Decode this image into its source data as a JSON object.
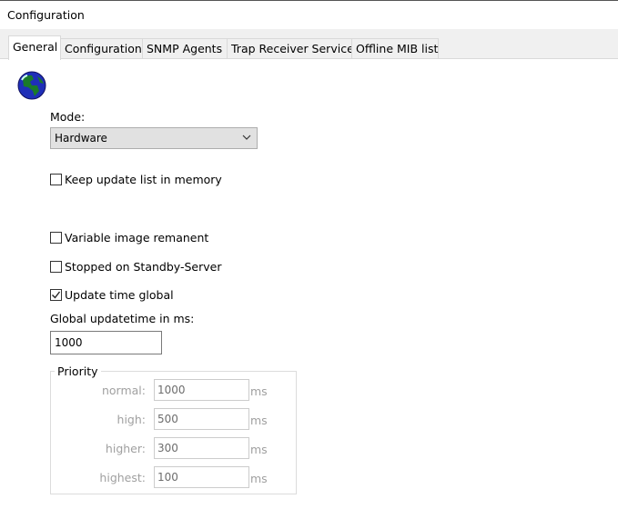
{
  "window": {
    "title": "Configuration"
  },
  "tabs": [
    {
      "label": "General",
      "selected": true
    },
    {
      "label": "Configuration"
    },
    {
      "label": "SNMP Agents"
    },
    {
      "label": "Trap Receiver Service"
    },
    {
      "label": "Offline MIB list"
    }
  ],
  "general": {
    "icon": "globe-icon",
    "mode_label": "Mode:",
    "mode_value": "Hardware",
    "keep_update": {
      "label": "Keep update list in memory",
      "checked": false
    },
    "variable_image": {
      "label": "Variable image remanent",
      "checked": false
    },
    "stopped_standby": {
      "label": "Stopped on Standby-Server",
      "checked": false
    },
    "update_time_global": {
      "label": "Update time global",
      "checked": true
    },
    "global_updatetime_label": "Global updatetime in ms:",
    "global_updatetime_value": "1000",
    "priority": {
      "legend": "Priority",
      "unit": "ms",
      "rows": [
        {
          "label": "normal:",
          "value": "1000"
        },
        {
          "label": "high:",
          "value": "500"
        },
        {
          "label": "higher:",
          "value": "300"
        },
        {
          "label": "highest:",
          "value": "100"
        }
      ]
    }
  }
}
